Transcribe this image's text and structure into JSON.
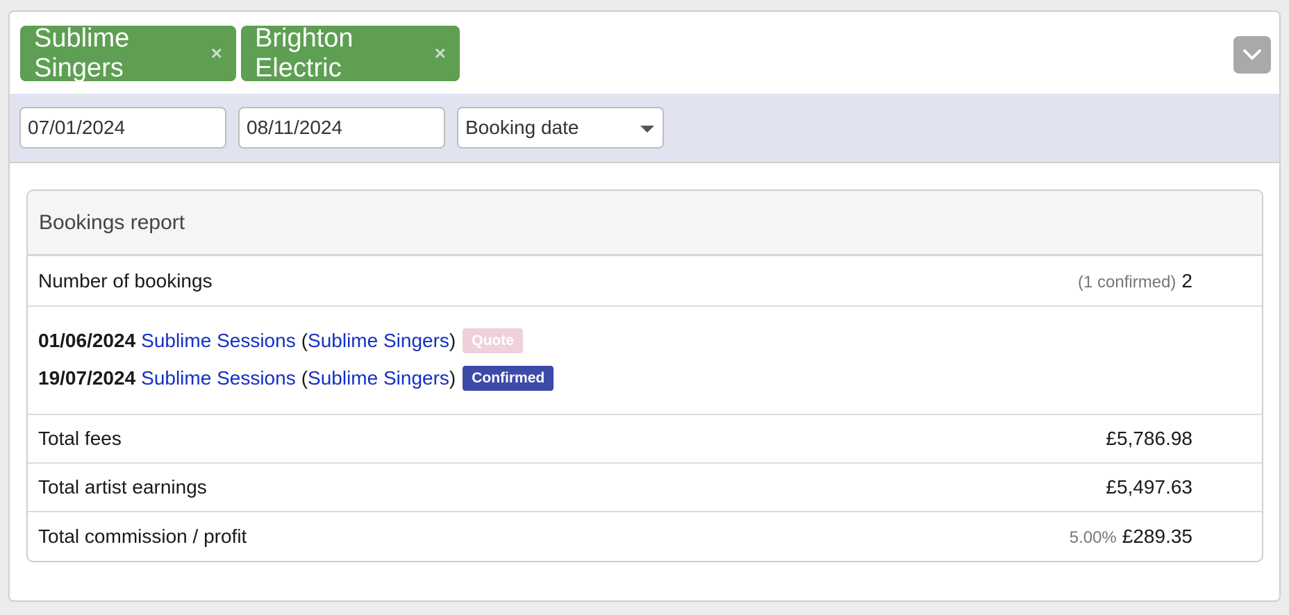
{
  "tags": [
    {
      "label": "Sublime Singers",
      "remove": "×"
    },
    {
      "label": "Brighton Electric",
      "remove": "×"
    }
  ],
  "toggle_icon": "chevron-down",
  "filters": {
    "start_date": "07/01/2024",
    "end_date": "08/11/2024",
    "date_type": "Booking date"
  },
  "report": {
    "title": "Bookings report",
    "number_of_bookings": {
      "label": "Number of bookings",
      "note": "(1 confirmed)",
      "value": "2"
    },
    "bookings": [
      {
        "date": "01/06/2024",
        "event": "Sublime Sessions",
        "open": "(",
        "artist": "Sublime Singers",
        "close": ")",
        "status": "Quote",
        "status_color": "#f0d0dc"
      },
      {
        "date": "19/07/2024",
        "event": "Sublime Sessions",
        "open": "(",
        "artist": "Sublime Singers",
        "close": ")",
        "status": "Confirmed",
        "status_color": "#3d4aa8"
      }
    ],
    "total_fees": {
      "label": "Total fees",
      "value": "£5,786.98"
    },
    "total_artist_earnings": {
      "label": "Total artist earnings",
      "value": "£5,497.63"
    },
    "total_commission": {
      "label": "Total commission / profit",
      "note": "5.00%",
      "value": "£289.35"
    }
  },
  "colors": {
    "tag_green": "#5e9f53",
    "filter_bg": "#e2e3f0",
    "link": "#1530c4"
  }
}
